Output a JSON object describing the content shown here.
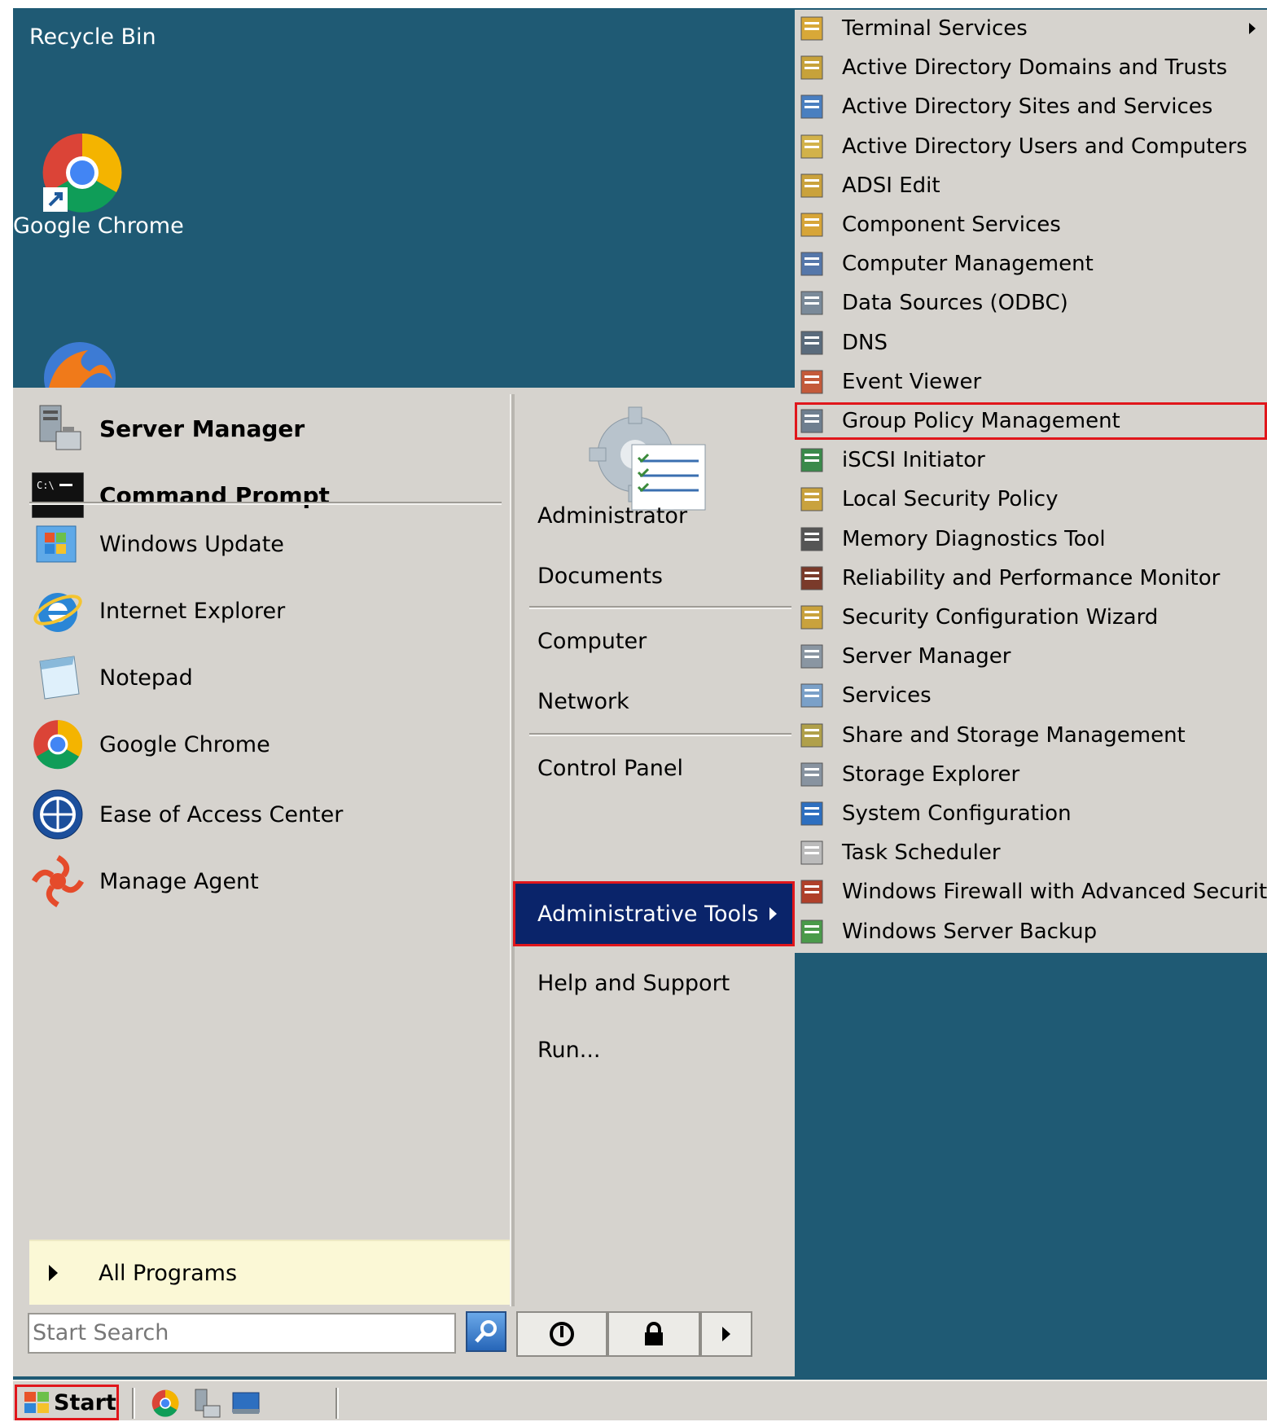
{
  "desktop": {
    "icons": [
      "Recycle Bin",
      "Google Chrome"
    ]
  },
  "start_menu": {
    "pinned": [
      "Server Manager",
      "Command Prompt"
    ],
    "recent": [
      "Windows Update",
      "Internet Explorer",
      "Notepad",
      "Google Chrome",
      "Ease of Access Center",
      "Manage Agent"
    ],
    "all_programs": "All Programs",
    "search_placeholder": "Start Search",
    "right": {
      "user": "Administrator",
      "documents": "Documents",
      "computer": "Computer",
      "network": "Network",
      "control_panel": "Control Panel",
      "admin_tools": "Administrative Tools",
      "help": "Help and Support",
      "run": "Run..."
    }
  },
  "submenu": {
    "items": [
      "Terminal Services",
      "Active Directory Domains and Trusts",
      "Active Directory Sites and Services",
      "Active Directory Users and Computers",
      "ADSI Edit",
      "Component Services",
      "Computer Management",
      "Data Sources (ODBC)",
      "DNS",
      "Event Viewer",
      "Group Policy Management",
      "iSCSI Initiator",
      "Local Security Policy",
      "Memory Diagnostics Tool",
      "Reliability and Performance Monitor",
      "Security Configuration Wizard",
      "Server Manager",
      "Services",
      "Share and Storage Management",
      "Storage Explorer",
      "System Configuration",
      "Task Scheduler",
      "Windows Firewall with Advanced Security",
      "Windows Server Backup"
    ]
  },
  "taskbar": {
    "start": "Start"
  }
}
